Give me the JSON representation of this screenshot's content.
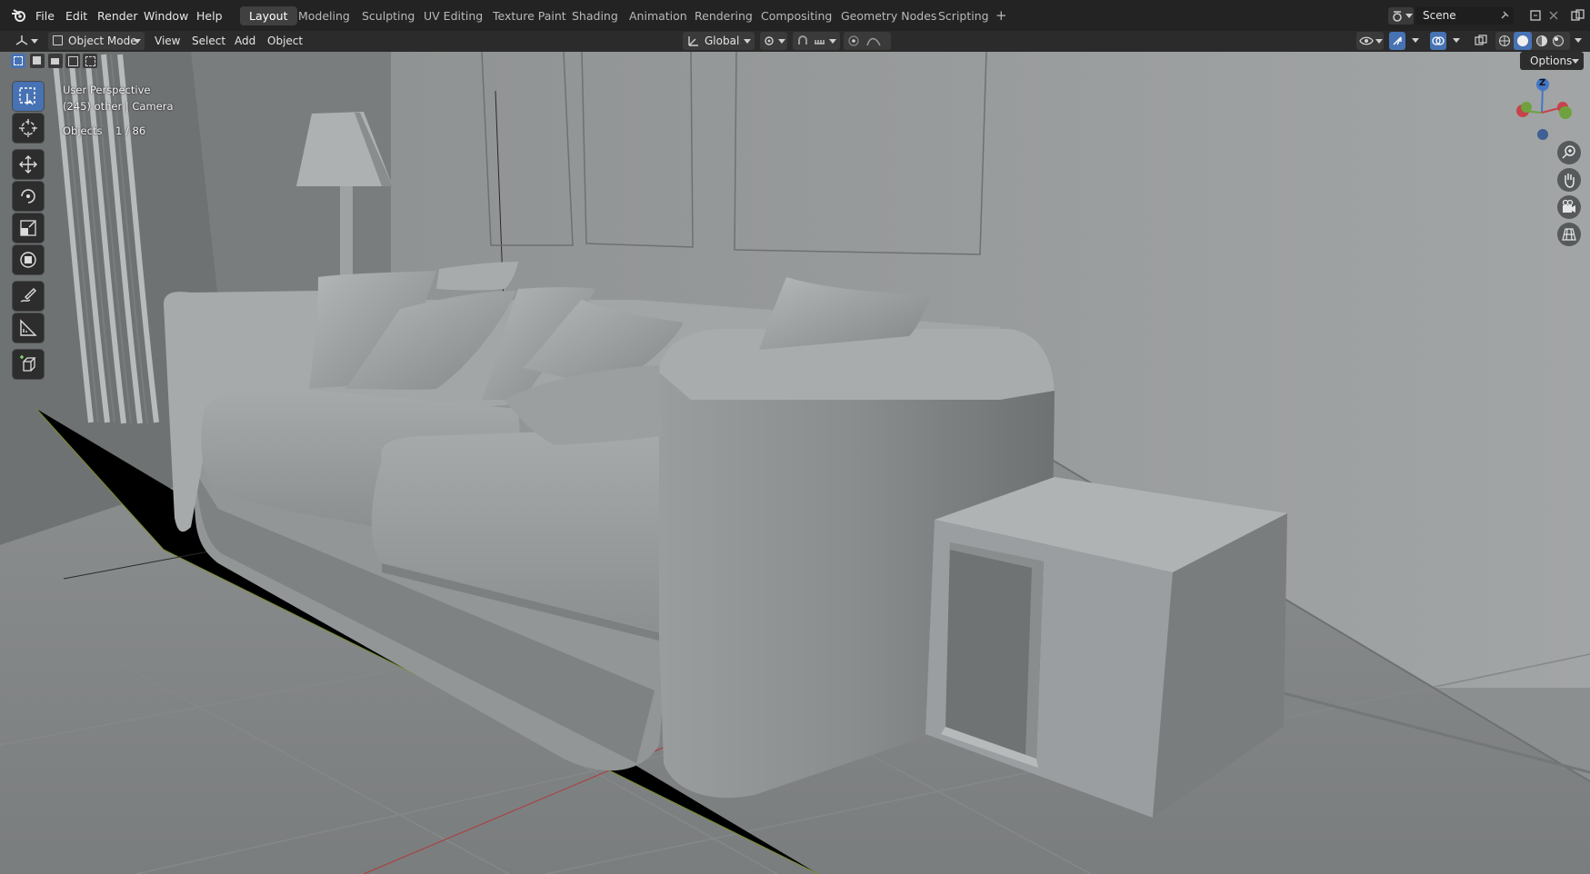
{
  "menu": [
    "File",
    "Edit",
    "Render",
    "Window",
    "Help"
  ],
  "workspaces": [
    "Layout",
    "Modeling",
    "Sculpting",
    "UV Editing",
    "Texture Paint",
    "Shading",
    "Animation",
    "Rendering",
    "Compositing",
    "Geometry Nodes",
    "Scripting"
  ],
  "add_workspace": "+",
  "scene": {
    "label": "Scene"
  },
  "header": {
    "mode": "Object Mode",
    "view_menu": [
      "View",
      "Select",
      "Add",
      "Object"
    ],
    "orientation": "Global"
  },
  "viewport": {
    "perspective": "User Perspective",
    "context": "(245) other | Camera",
    "objects_label": "Objects",
    "objects_count": "1 / 86",
    "options": "Options"
  },
  "gizmo": {
    "z": "Z",
    "x_color": "#c7434b",
    "y_color": "#6fa13e",
    "z_color": "#4476c8"
  },
  "colors": {
    "accent": "#4772b3",
    "topbar": "#232323",
    "header": "#2b2b2b"
  },
  "toolbar_icons": [
    "select-box-icon",
    "cursor-icon",
    "move-icon",
    "rotate-icon",
    "scale-icon",
    "transform-icon",
    "annotate-icon",
    "measure-icon",
    "add-cube-icon"
  ],
  "nav_icons": [
    "zoom-icon",
    "pan-hand-icon",
    "camera-view-icon",
    "ortho-grid-icon"
  ]
}
